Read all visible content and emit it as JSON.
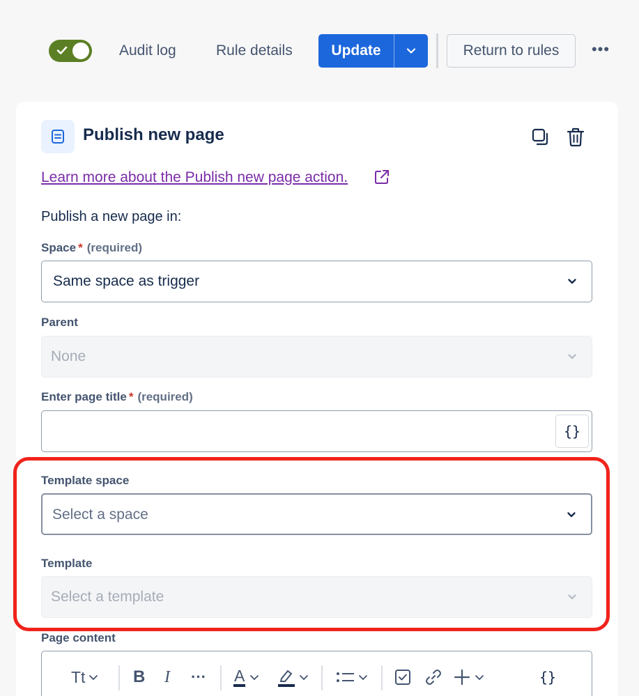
{
  "toolbar": {
    "toggle_state": "enabled",
    "audit_log": "Audit log",
    "rule_details": "Rule details",
    "update_label": "Update",
    "return_label": "Return to rules",
    "more_label": "•••"
  },
  "card": {
    "title": "Publish new page",
    "learn_more": "Learn more about the Publish new page action.",
    "intro": "Publish a new page in:",
    "space": {
      "label": "Space",
      "required_marker": "*",
      "required_text": "(required)",
      "value": "Same space as trigger"
    },
    "parent": {
      "label": "Parent",
      "value": "None"
    },
    "page_title": {
      "label": "Enter page title",
      "required_marker": "*",
      "required_text": "(required)",
      "value": "",
      "smart_value_label": "{}"
    },
    "template_space": {
      "label": "Template space",
      "placeholder": "Select a space"
    },
    "template": {
      "label": "Template",
      "placeholder": "Select a template"
    },
    "page_content": {
      "label": "Page content",
      "toolbar": {
        "text_style": "Tt",
        "bold": "B",
        "italic": "I",
        "more": "···",
        "text_color": "A",
        "smart_value": "{}"
      }
    }
  },
  "colors": {
    "accent_blue": "#1d67dc",
    "toggle_green": "#5b7f24",
    "link_purple": "#7a2ca8",
    "highlight_red": "#f0231b",
    "required_red": "#c9372c"
  },
  "icons": [
    "check-icon",
    "chevron-down-icon",
    "page-icon",
    "copy-icon",
    "trash-icon",
    "external-link-icon",
    "highlighter-icon",
    "list-icon",
    "checkbox-icon",
    "link-icon",
    "plus-icon"
  ]
}
